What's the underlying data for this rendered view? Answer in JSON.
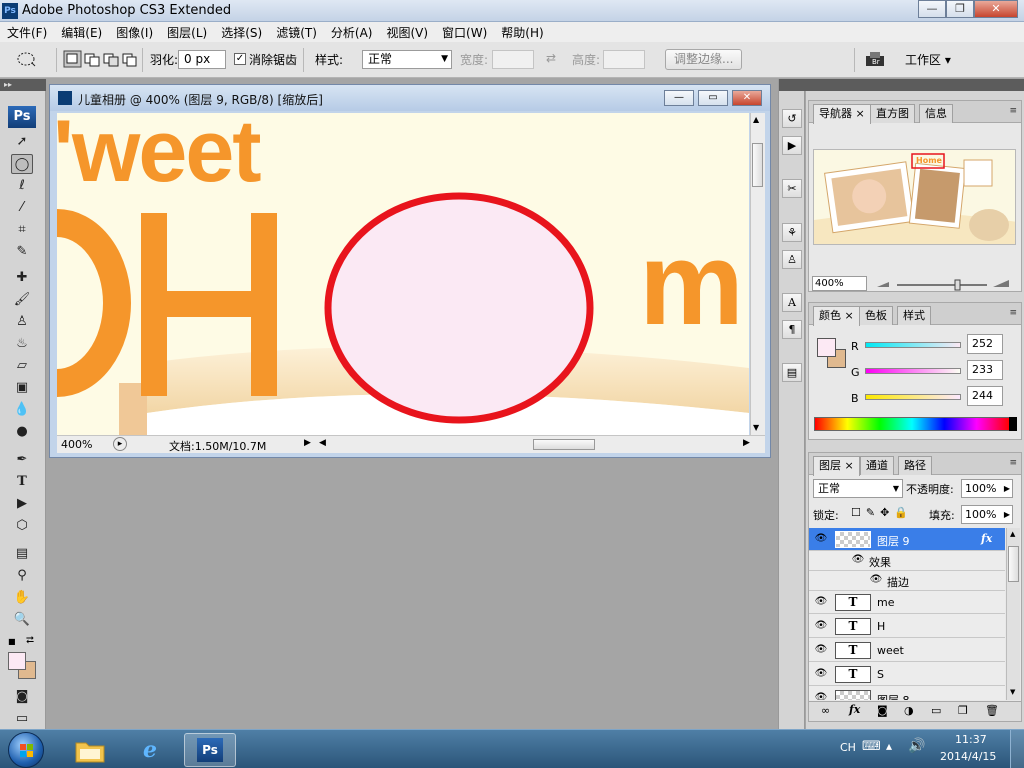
{
  "app": {
    "title": "Adobe Photoshop CS3 Extended",
    "icon_label": "Ps"
  },
  "window_buttons": {
    "minimize": "—",
    "restore": "❐",
    "close": "✕"
  },
  "menu": [
    "文件(F)",
    "编辑(E)",
    "图像(I)",
    "图层(L)",
    "选择(S)",
    "滤镜(T)",
    "分析(A)",
    "视图(V)",
    "窗口(W)",
    "帮助(H)"
  ],
  "options": {
    "feather_label": "羽化:",
    "feather_value": "0 px",
    "antialias_label": "消除锯齿",
    "antialias_checked": true,
    "style_label": "样式:",
    "style_value": "正常",
    "width_label": "宽度:",
    "height_label": "高度:",
    "refine_edge": "调整边缘...",
    "workspace": "工作区 ▾"
  },
  "toolbox": {
    "logo": "Ps",
    "tools": [
      "move-tool",
      "elliptical-marquee-tool",
      "lasso-tool",
      "magic-wand-tool",
      "crop-tool",
      "slice-tool",
      "healing-brush-tool",
      "brush-tool",
      "clone-stamp-tool",
      "history-brush-tool",
      "eraser-tool",
      "gradient-tool",
      "blur-tool",
      "dodge-tool",
      "pen-tool",
      "type-tool",
      "path-selection-tool",
      "shape-tool",
      "notes-tool",
      "eyedropper-tool",
      "hand-tool",
      "zoom-tool"
    ],
    "foreground_color": "#fce9f4",
    "background_color": "#e0b98f"
  },
  "document": {
    "title": "儿童相册 @ 400% (图层 9, RGB/8) [缩放后]",
    "zoom": "400%",
    "doc_info": "文档:1.50M/10.7M",
    "canvas_text": {
      "word1": "'weet",
      "letter_h": "H",
      "letter_m": "m"
    },
    "colors": {
      "background": "#fefbe5",
      "text": "#f5962b",
      "ring": "#e8141c",
      "ring_fill": "#fbe9f4"
    }
  },
  "navigator": {
    "tabs": [
      "导航器",
      "直方图",
      "信息"
    ],
    "zoom": "400%",
    "thumb_text": "Home"
  },
  "color_panel": {
    "tabs": [
      "颜色",
      "色板",
      "样式"
    ],
    "r_label": "R",
    "r": "252",
    "g_label": "G",
    "g": "233",
    "b_label": "B",
    "b": "244",
    "fg": "#fce9f4",
    "bg": "#e0b98f"
  },
  "layers_panel": {
    "tabs": [
      "图层",
      "通道",
      "路径"
    ],
    "blend_mode": "正常",
    "opacity_label": "不透明度:",
    "opacity": "100%",
    "lock_label": "锁定:",
    "fill_label": "填充:",
    "fill": "100%",
    "layers": [
      {
        "name": "图层 9",
        "kind": "pixel",
        "selected": true,
        "fx": "fx"
      },
      {
        "name": "效果",
        "kind": "effect-group"
      },
      {
        "name": "描边",
        "kind": "effect"
      },
      {
        "name": "me",
        "kind": "type"
      },
      {
        "name": "H",
        "kind": "type"
      },
      {
        "name": "weet",
        "kind": "type"
      },
      {
        "name": "S",
        "kind": "type"
      },
      {
        "name": "图层 8",
        "kind": "pixel"
      }
    ]
  },
  "taskbar": {
    "lang": "CH",
    "time": "11:37",
    "date": "2014/4/15",
    "ps_label": "Ps"
  }
}
